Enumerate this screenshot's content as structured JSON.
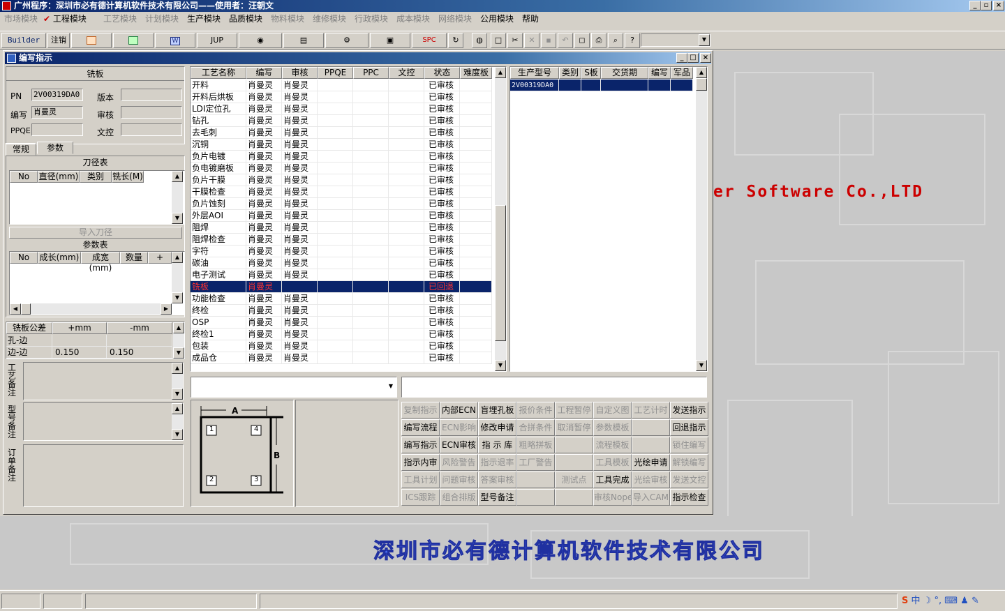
{
  "app": {
    "title": "广州程序：深圳市必有德计算机软件技术有限公司——使用者：汪朝文"
  },
  "menu": [
    {
      "label": "市场模块",
      "enabled": false
    },
    {
      "label": "工程模块",
      "enabled": true,
      "checked": true
    },
    {
      "label": "工艺模块",
      "enabled": false
    },
    {
      "label": "计划模块",
      "enabled": false
    },
    {
      "label": "生产模块",
      "enabled": true
    },
    {
      "label": "品质模块",
      "enabled": true
    },
    {
      "label": "物料模块",
      "enabled": false
    },
    {
      "label": "维修模块",
      "enabled": false
    },
    {
      "label": "行政模块",
      "enabled": false
    },
    {
      "label": "成本模块",
      "enabled": false
    },
    {
      "label": "网络模块",
      "enabled": false
    },
    {
      "label": "公用模块",
      "enabled": true
    },
    {
      "label": "帮助",
      "enabled": true
    }
  ],
  "toolbar": {
    "builder": "Builder",
    "logout": "注销",
    "jup": "JUP",
    "spc": "SPC"
  },
  "window": {
    "title": "编写指示"
  },
  "left": {
    "section_title": "铣板",
    "pn_label": "PN",
    "pn_value": "2V00319DA0",
    "version_label": "版本",
    "version_value": "",
    "writer_label": "编写",
    "writer_value": "肖曼灵",
    "audit_label": "审核",
    "audit_value": "",
    "ppqe_label": "PPQE",
    "ppqe_value": "",
    "doc_label": "文控",
    "doc_value": "",
    "tabs": [
      "常规",
      "参数"
    ],
    "tool_table_title": "刀径表",
    "tool_cols": [
      "No",
      "直径(mm)",
      "类别",
      "铣长(M)"
    ],
    "import_tool": "导入刀径",
    "param_table_title": "参数表",
    "param_cols": [
      "No",
      "成长(mm)",
      "成宽(mm)",
      "数量",
      "+"
    ],
    "tol_cols": [
      "铣板公差",
      "+mm",
      "-mm"
    ],
    "tol_rows": [
      {
        "name": "孔-边",
        "plus": "",
        "minus": ""
      },
      {
        "name": "边-边",
        "plus": "0.150",
        "minus": "0.150"
      }
    ],
    "note1": "工艺备注",
    "note2": "型号备注",
    "note3": "订单备注"
  },
  "process": {
    "cols": [
      "工艺名称",
      "编写",
      "审核",
      "PPQE",
      "PPC",
      "文控",
      "状态",
      "难度板"
    ],
    "rows": [
      {
        "name": "开料",
        "w": "肖曼灵",
        "a": "肖曼灵",
        "s": "已审核"
      },
      {
        "name": "开料后烘板",
        "w": "肖曼灵",
        "a": "肖曼灵",
        "s": "已审核"
      },
      {
        "name": "LDI定位孔",
        "w": "肖曼灵",
        "a": "肖曼灵",
        "s": "已审核"
      },
      {
        "name": "钻孔",
        "w": "肖曼灵",
        "a": "肖曼灵",
        "s": "已审核"
      },
      {
        "name": "去毛刺",
        "w": "肖曼灵",
        "a": "肖曼灵",
        "s": "已审核"
      },
      {
        "name": "沉铜",
        "w": "肖曼灵",
        "a": "肖曼灵",
        "s": "已审核"
      },
      {
        "name": "负片电镀",
        "w": "肖曼灵",
        "a": "肖曼灵",
        "s": "已审核"
      },
      {
        "name": "负电镀磨板",
        "w": "肖曼灵",
        "a": "肖曼灵",
        "s": "已审核"
      },
      {
        "name": "负片干膜",
        "w": "肖曼灵",
        "a": "肖曼灵",
        "s": "已审核"
      },
      {
        "name": "干膜检查",
        "w": "肖曼灵",
        "a": "肖曼灵",
        "s": "已审核"
      },
      {
        "name": "负片蚀刻",
        "w": "肖曼灵",
        "a": "肖曼灵",
        "s": "已审核"
      },
      {
        "name": "外层AOI",
        "w": "肖曼灵",
        "a": "肖曼灵",
        "s": "已审核"
      },
      {
        "name": "阻焊",
        "w": "肖曼灵",
        "a": "肖曼灵",
        "s": "已审核"
      },
      {
        "name": "阻焊检查",
        "w": "肖曼灵",
        "a": "肖曼灵",
        "s": "已审核"
      },
      {
        "name": "字符",
        "w": "肖曼灵",
        "a": "肖曼灵",
        "s": "已审核"
      },
      {
        "name": "碳油",
        "w": "肖曼灵",
        "a": "肖曼灵",
        "s": "已审核"
      },
      {
        "name": "电子测试",
        "w": "肖曼灵",
        "a": "肖曼灵",
        "s": "已审核"
      },
      {
        "name": "铣板",
        "w": "肖曼灵",
        "a": "",
        "s": "已回退",
        "selected": true
      },
      {
        "name": "功能检查",
        "w": "肖曼灵",
        "a": "肖曼灵",
        "s": "已审核"
      },
      {
        "name": "终检",
        "w": "肖曼灵",
        "a": "肖曼灵",
        "s": "已审核"
      },
      {
        "name": "OSP",
        "w": "肖曼灵",
        "a": "肖曼灵",
        "s": "已审核"
      },
      {
        "name": "终检1",
        "w": "肖曼灵",
        "a": "肖曼灵",
        "s": "已审核"
      },
      {
        "name": "包装",
        "w": "肖曼灵",
        "a": "肖曼灵",
        "s": "已审核"
      },
      {
        "name": "成品仓",
        "w": "肖曼灵",
        "a": "肖曼灵",
        "s": "已审核"
      }
    ]
  },
  "models": {
    "cols": [
      "生产型号",
      "类别",
      "S板",
      "交货期",
      "编写",
      "军品"
    ],
    "rows": [
      {
        "model": "2V00319DA0"
      }
    ]
  },
  "diagram": {
    "a": "A",
    "b": "B",
    "n1": "1",
    "n2": "2",
    "n3": "3",
    "n4": "4"
  },
  "actions": [
    [
      "复制指示",
      "内部ECN",
      "盲埋孔板",
      "报价条件",
      "工程暂停",
      "自定义图",
      "工艺计时",
      "发送指示"
    ],
    [
      "编写流程",
      "ECN影响",
      "修改申请",
      "合拼条件",
      "取消暂停",
      "参数模板",
      "",
      "回退指示"
    ],
    [
      "编写指示",
      "ECN审核",
      "指 示 库",
      "粗略拼板",
      "",
      "流程模板",
      "",
      "锁住编写"
    ],
    [
      "指示内审",
      "风险警告",
      "指示退率",
      "工厂警告",
      "",
      "工具模板",
      "光绘申请",
      "解锁编写"
    ],
    [
      "工具计划",
      "问题审核",
      "答案审核",
      "",
      "测试点",
      "工具完成",
      "光绘审核",
      "发送文控"
    ],
    [
      "ICS跟踪",
      "组合排版",
      "型号备注",
      "",
      "",
      "审核Nope",
      "导入CAM",
      "指示检查"
    ]
  ],
  "actions_enabled": [
    [
      false,
      true,
      true,
      false,
      false,
      false,
      false,
      true
    ],
    [
      true,
      false,
      true,
      false,
      false,
      false,
      false,
      true
    ],
    [
      true,
      true,
      true,
      false,
      false,
      false,
      false,
      false
    ],
    [
      true,
      false,
      false,
      false,
      false,
      false,
      true,
      false
    ],
    [
      false,
      false,
      false,
      false,
      false,
      true,
      false,
      false
    ],
    [
      false,
      false,
      true,
      false,
      false,
      false,
      false,
      true
    ]
  ],
  "desktop": {
    "brand": "er Software Co.,LTD",
    "company": "深圳市必有德计算机软件技术有限公司"
  },
  "tray": {
    "ime": "中"
  }
}
